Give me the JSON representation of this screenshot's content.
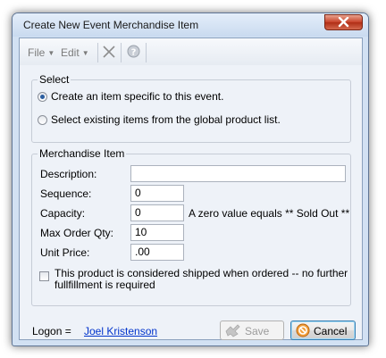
{
  "window": {
    "title": "Create New Event Merchandise Item"
  },
  "toolbar": {
    "file_label": "File",
    "edit_label": "Edit",
    "caret": "▼"
  },
  "select_group": {
    "legend": "Select",
    "option_specific": "Create an item specific to this event.",
    "option_existing": "Select existing items from the global product list.",
    "selected": "option_specific"
  },
  "merch_group": {
    "legend": "Merchandise Item",
    "description_label": "Description:",
    "description_value": "",
    "sequence_label": "Sequence:",
    "sequence_value": "0",
    "capacity_label": "Capacity:",
    "capacity_value": "0",
    "capacity_hint": "A zero value equals ** Sold Out **",
    "max_order_label": "Max Order Qty:",
    "max_order_value": "10",
    "unit_price_label": "Unit Price:",
    "unit_price_value": ".00",
    "shipped_text": "This product is considered shipped when ordered -- no further fullfillment is required",
    "shipped_checked": false
  },
  "footer": {
    "logon_label": "Logon =",
    "logon_user": "Joel Kristenson",
    "save_label": "Save",
    "cancel_label": "Cancel"
  },
  "colors": {
    "window_frame": "#d2e1f3",
    "client_bg": "#eef2f8",
    "link": "#0033cc",
    "close_button": "#c9452c"
  }
}
